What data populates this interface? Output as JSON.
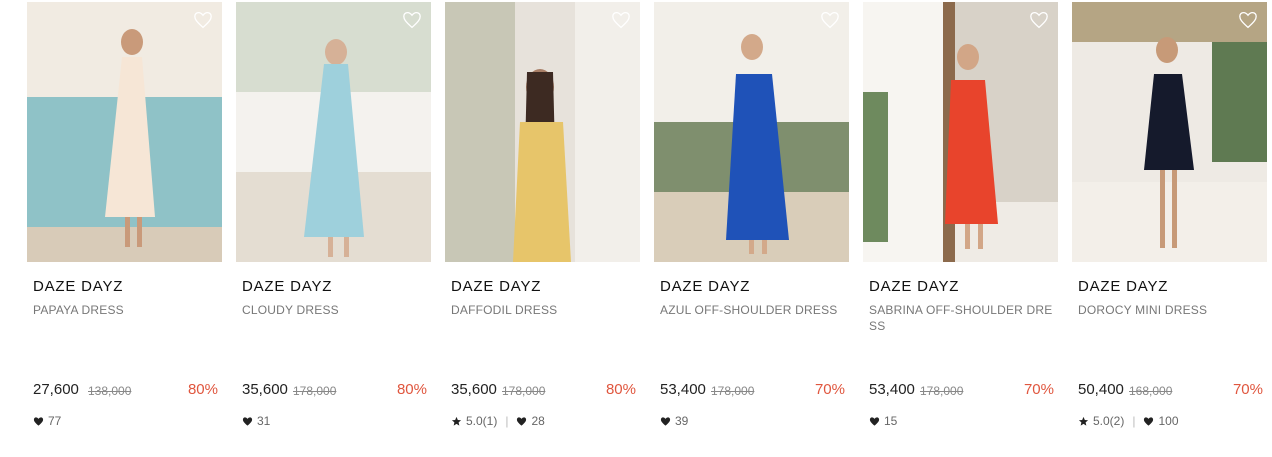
{
  "products": [
    {
      "brand": "DAZE DAYZ",
      "name": "PAPAYA DRESS",
      "price": "27,600",
      "original_price": "138,000",
      "discount": "80%",
      "rating": "",
      "likes": "77"
    },
    {
      "brand": "DAZE DAYZ",
      "name": "CLOUDY DRESS",
      "price": "35,600",
      "original_price": "178,000",
      "discount": "80%",
      "rating": "",
      "likes": "31"
    },
    {
      "brand": "DAZE DAYZ",
      "name": "DAFFODIL DRESS",
      "price": "35,600",
      "original_price": "178,000",
      "discount": "80%",
      "rating": "5.0(1)",
      "likes": "28"
    },
    {
      "brand": "DAZE DAYZ",
      "name": "AZUL OFF-SHOULDER DRESS",
      "price": "53,400",
      "original_price": "178,000",
      "discount": "70%",
      "rating": "",
      "likes": "39"
    },
    {
      "brand": "DAZE DAYZ",
      "name": "SABRINA OFF-SHOULDER DRESS",
      "price": "53,400",
      "original_price": "178,000",
      "discount": "70%",
      "rating": "",
      "likes": "15"
    },
    {
      "brand": "DAZE DAYZ",
      "name": "DOROCY MINI DRESS",
      "price": "50,400",
      "original_price": "168,000",
      "discount": "70%",
      "rating": "5.0(2)",
      "likes": "100"
    }
  ],
  "icons": {
    "wishlist": "heart-outline-icon",
    "likes": "heart-filled-icon",
    "rating": "star-icon"
  },
  "colors": {
    "discount": "#e0563e",
    "text": "#222222",
    "muted": "#777777"
  }
}
